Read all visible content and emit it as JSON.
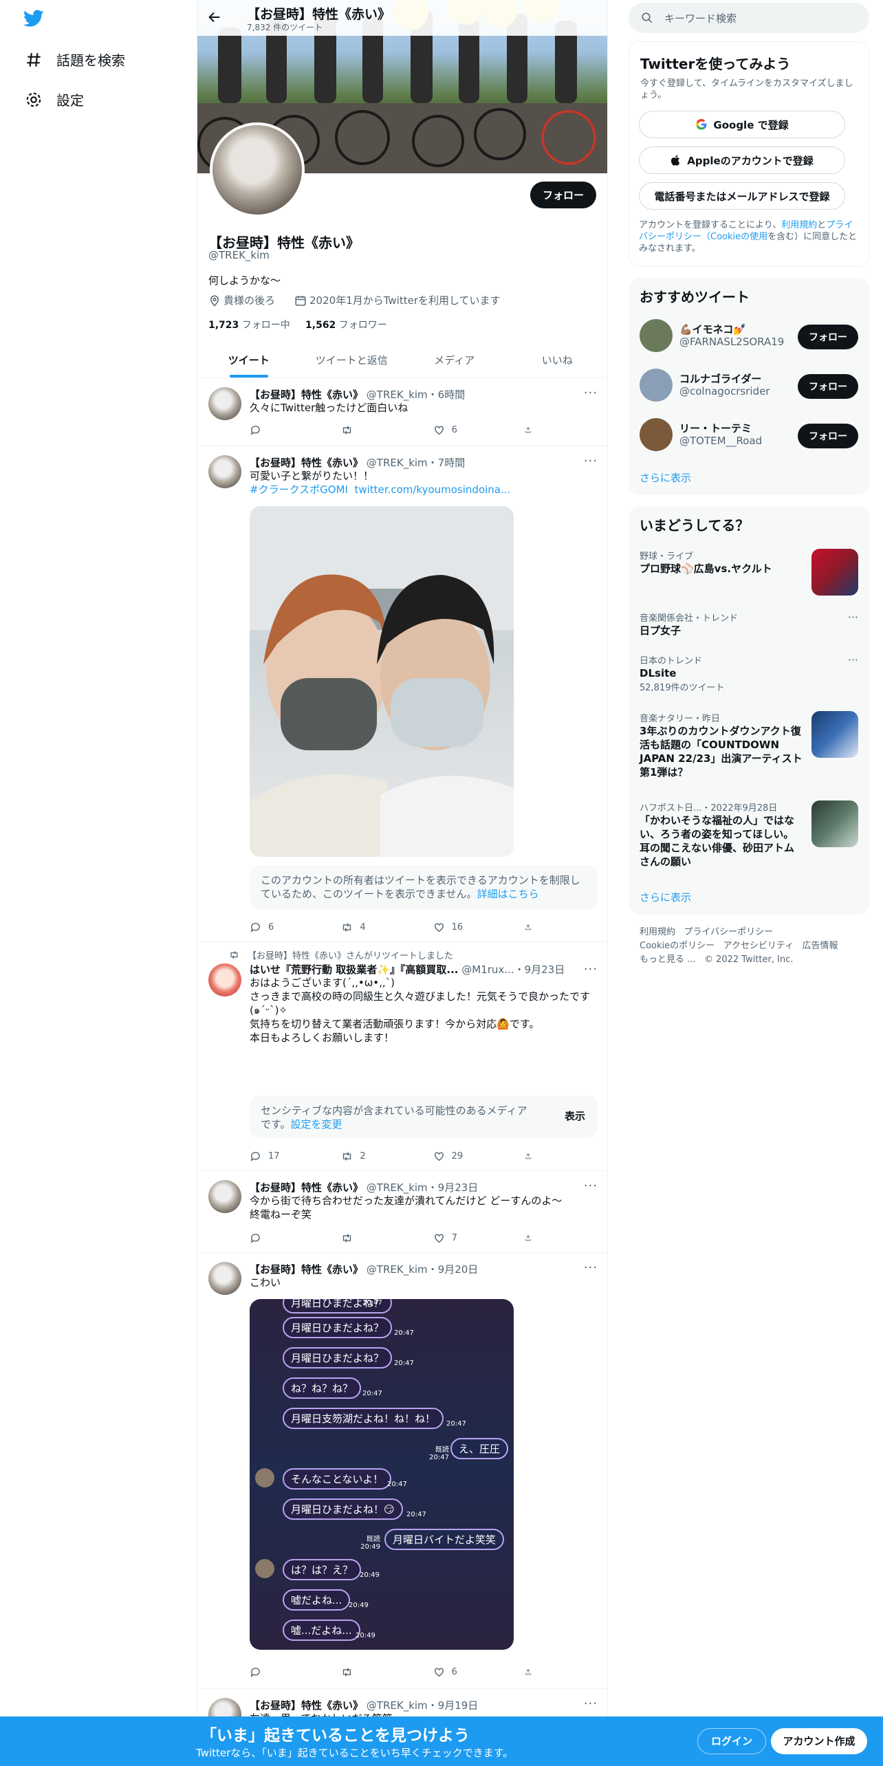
{
  "nav": {
    "explore": "話題を検索",
    "settings": "設定"
  },
  "header": {
    "name": "【お昼時】特性《赤い》",
    "count": "7,832 件のツイート"
  },
  "profile": {
    "follow": "フォロー",
    "name": "【お昼時】特性《赤い》",
    "handle": "@TREK_kim",
    "bio": "何しようかな〜",
    "location": "貴様の後ろ",
    "joined": "2020年1月からTwitterを利用しています",
    "following_count": "1,723",
    "following_label": "フォロー中",
    "followers_count": "1,562",
    "followers_label": "フォロワー"
  },
  "tabs": [
    "ツイート",
    "ツイートと返信",
    "メディア",
    "いいね"
  ],
  "tweets": [
    {
      "name": "【お昼時】特性《赤い》",
      "meta": "@TREK_kim・6時間",
      "text": "久々にTwitter触ったけど面白いね",
      "reply": "",
      "rt": "",
      "like": "6"
    },
    {
      "name": "【お昼時】特性《赤い》",
      "meta": "@TREK_kim・7時間",
      "text": "可愛い子と繋がりたい！！",
      "hashtag": "#クラークスポGOMI",
      "link": "twitter.com/kyoumosindoina...",
      "notice": "このアカウントの所有者はツイートを表示できるアカウントを制限しているため、このツイートを表示できません。",
      "notice_link": "詳細はこちら",
      "reply": "6",
      "rt": "4",
      "like": "16"
    },
    {
      "rt_by": "【お昼時】特性《赤い》さんがリツイートしました",
      "name": "はいせ『荒野行動 取扱業者✨』『高額買取...",
      "meta": "@M1rux...・9月23日",
      "lines": [
        "おはようございます(´,,•ω•,,`)",
        "",
        "さっきまで高校の時の同級生と久々遊びました！元気そうで良かったです(๑ˊᵕˋ)✧",
        "",
        "気持ちを切り替えて業者活動頑張ります！今から対応🙆です。",
        "",
        "本日もよろしくお願いします！"
      ],
      "sensitive": "センシティブな内容が含まれている可能性のあるメディアです。",
      "sensitive_link": "設定を変更",
      "show": "表示",
      "reply": "17",
      "rt": "2",
      "like": "29"
    },
    {
      "name": "【お昼時】特性《赤い》",
      "meta": "@TREK_kim・9月23日",
      "lines": [
        "今から街で待ち合わせだった友達が潰れてんだけど どーすんのよ〜",
        "終電ねーぞ笑"
      ],
      "reply": "",
      "rt": "",
      "like": "7"
    },
    {
      "name": "【お昼時】特性《赤い》",
      "meta": "@TREK_kim・9月20日",
      "text": "こわい",
      "reply": "",
      "rt": "",
      "like": "6"
    },
    {
      "name": "【お昼時】特性《赤い》",
      "meta": "@TREK_kim・9月19日",
      "text": "友達＝男っておかしいだろ笑笑"
    }
  ],
  "chat": [
    {
      "t": "月曜日ひまだよね？",
      "time": "20:47"
    },
    {
      "t": "月曜日ひまだよね？",
      "time": "20:47"
    },
    {
      "t": "ね？ね？ね？",
      "time": "20:47"
    },
    {
      "t": "月曜日支笏湖だよね！ね！ね！",
      "time": "20:47"
    },
    {
      "t": "え、圧圧",
      "time": "既読 20:47"
    },
    {
      "t": "そんなことないよ！",
      "time": "20:47"
    },
    {
      "t": "月曜日ひまだよね！😏",
      "time": "20:47"
    },
    {
      "t": "月曜日バイトだよ笑笑",
      "time": "既読 20:49"
    },
    {
      "t": "は？は？え？",
      "time": "20:49"
    },
    {
      "t": "嘘だよね...",
      "time": "20:49"
    },
    {
      "t": "嘘...だよね...",
      "time": "20:49"
    }
  ],
  "right": {
    "search_placeholder": "キーワード検索",
    "signup_title": "Twitterを使ってみよう",
    "signup_sub": "今すぐ登録して、タイムラインをカスタマイズしましょう。",
    "google": "Google で登録",
    "apple": "Appleのアカウントで登録",
    "phone": "電話番号またはメールアドレスで登録",
    "terms_pre": "アカウントを登録することにより、",
    "terms_link1": "利用規約",
    "terms_and": "と",
    "terms_link2": "プライバシーポリシー（Cookieの使用",
    "terms_post": "を含む）に同意したとみなされます。",
    "rec_title": "おすすめツイート",
    "rec": [
      {
        "name": "💪🏽イモネコ💅",
        "handle": "@FARNASL2SORA19",
        "follow": "フォロー",
        "color": "#6b7a5a"
      },
      {
        "name": "コルナゴライダー",
        "handle": "@colnagocrsrider",
        "follow": "フォロー",
        "color": "#8a9fb5"
      },
      {
        "name": "リー・トーテミ",
        "handle": "@TOTEM__Road",
        "follow": "フォロー",
        "color": "#7a5a3a"
      }
    ],
    "more": "さらに表示",
    "trend_title": "いまどうしてる？",
    "trends": [
      {
        "cat": "野球・ライブ",
        "title": "プロ野球⚾広島vs.ヤクルト"
      },
      {
        "cat": "音楽関係会社・トレンド",
        "title": "日プ女子"
      },
      {
        "cat": "日本のトレンド",
        "title": "DLsite",
        "num": "52,819件のツイート"
      },
      {
        "cat": "音楽ナタリー・昨日",
        "title": "3年ぶりのカウントダウンアクト復活も話題の「COUNTDOWN JAPAN 22/23」出演アーティスト第1弾は？"
      },
      {
        "cat": "ハフポスト日...・2022年9月28日",
        "title": "「かわいそうな福祉の人」ではない、ろう者の姿を知ってほしい。耳の聞こえない俳優、砂田アトムさんの願い"
      }
    ],
    "footer": [
      "利用規約",
      "プライバシーポリシー",
      "Cookieのポリシー",
      "アクセシビリティ",
      "広告情報",
      "もっと見る ...",
      "© 2022 Twitter, Inc."
    ]
  },
  "bottom": {
    "title": "「いま」起きていることを見つけよう",
    "sub": "Twitterなら、「いま」起きていることをいち早くチェックできます。",
    "login": "ログイン",
    "signup": "アカウント作成"
  }
}
